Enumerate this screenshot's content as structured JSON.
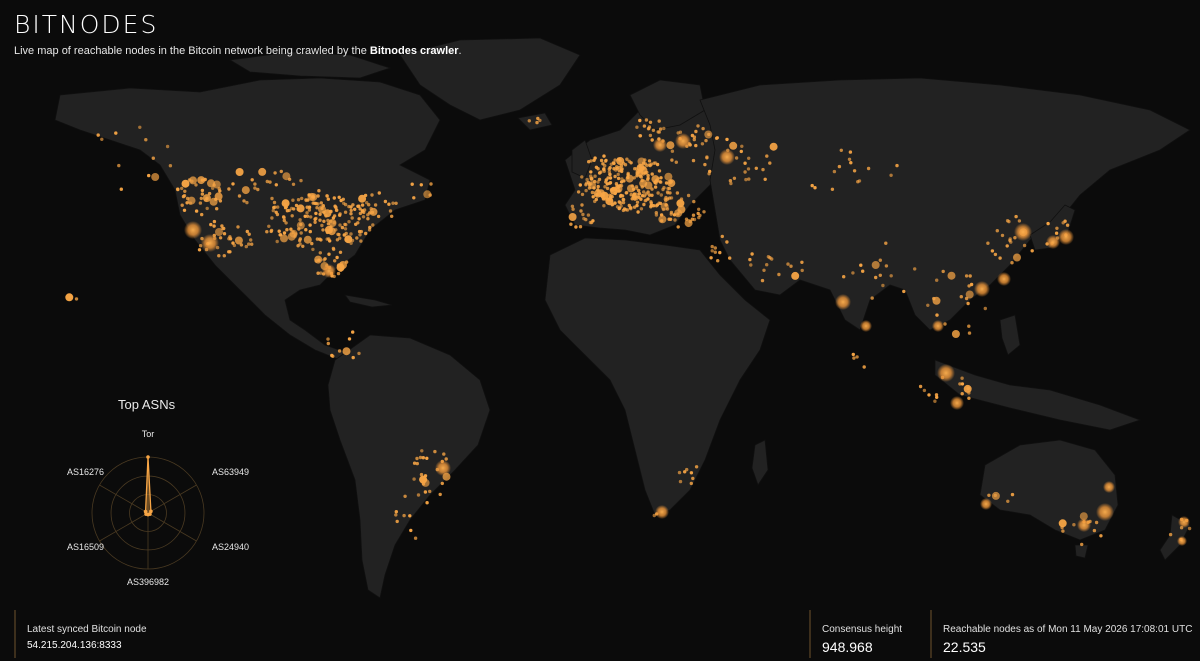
{
  "header": {
    "logo": "BITNODES",
    "subtitle_prefix": "Live map of reachable nodes in the Bitcoin network being crawled by the ",
    "subtitle_link": "Bitnodes crawler",
    "subtitle_suffix": "."
  },
  "top_asns": {
    "title": "Top ASNs",
    "labels": [
      "Tor",
      "AS63949",
      "AS24940",
      "AS396982",
      "AS16509",
      "AS16276"
    ],
    "values": [
      1.0,
      0.06,
      0.04,
      0.03,
      0.04,
      0.05
    ]
  },
  "stats": {
    "latest_node_label": "Latest synced Bitcoin node",
    "latest_node_value": "54.215.204.136:8333",
    "consensus_label": "Consensus height",
    "consensus_value": "948.968",
    "reachable_label": "Reachable nodes as of Mon 11 May 2026 17:08:01 UTC",
    "reachable_value": "22.535"
  },
  "colors": {
    "background": "#0b0b0b",
    "land": "#222222",
    "land_border": "#0f0f0f",
    "node": "#f7a545"
  }
}
